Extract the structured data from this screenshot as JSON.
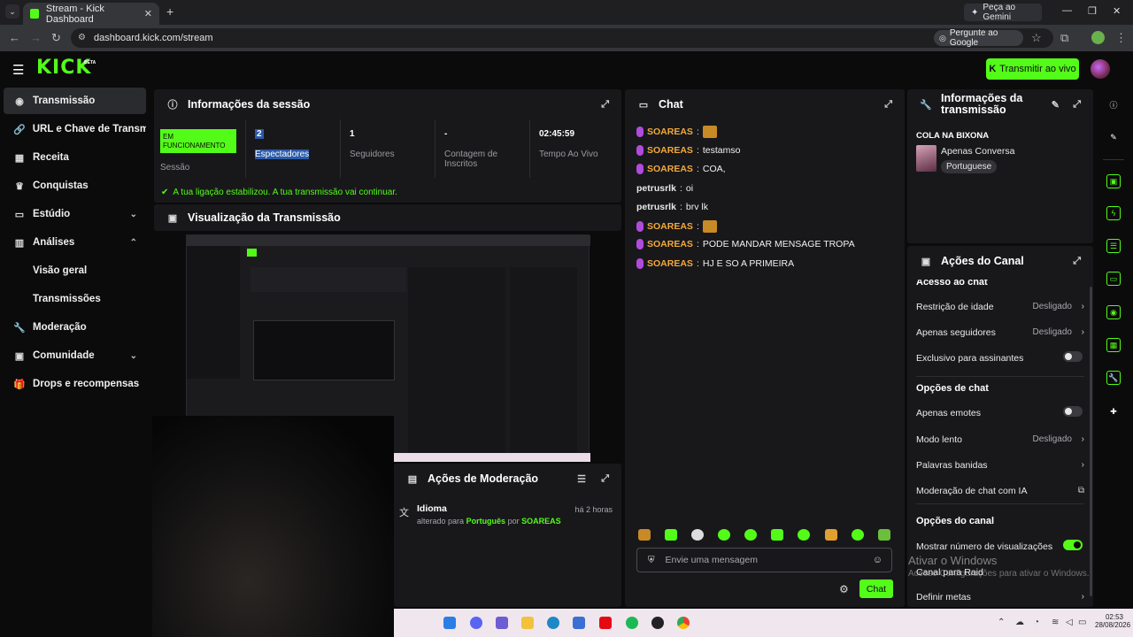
{
  "browser": {
    "tab_title": "Stream - Kick Dashboard",
    "gemini_label": "Peça ao Gemini",
    "url": "dashboard.kick.com/stream",
    "ask_google_label": "Pergunte ao Google"
  },
  "header": {
    "logo": "KICK",
    "logo_badge": "BETA",
    "go_live_label": "Transmitir ao vivo"
  },
  "sidebar": {
    "items": [
      {
        "label": "Transmissão"
      },
      {
        "label": "URL e Chave de Transmissão"
      },
      {
        "label": "Receita"
      },
      {
        "label": "Conquistas"
      },
      {
        "label": "Estúdio"
      },
      {
        "label": "Análises"
      },
      {
        "label": "Moderação"
      },
      {
        "label": "Comunidade"
      },
      {
        "label": "Drops e recompensas"
      }
    ],
    "sub_items": [
      "Visão geral",
      "Transmissões"
    ]
  },
  "session": {
    "title": "Informações da sessão",
    "status_badge": "EM FUNCIONAMENTO",
    "status_label": "Sessão",
    "viewers_value": "2",
    "viewers_label": "Espectadores",
    "followers_value": "1",
    "followers_label": "Seguidores",
    "subs_value": "-",
    "subs_label": "Contagem de Inscritos",
    "uptime_value": "02:45:59",
    "uptime_label": "Tempo Ao Vivo",
    "notice": "A tua ligação estabilizou. A tua transmissão vai continuar."
  },
  "preview": {
    "title": "Visualização da Transmissão"
  },
  "moderation": {
    "title": "Ações de Moderação",
    "item_title": "Idioma",
    "item_time": "há 2 horas",
    "item_prefix": "alterado para",
    "item_value": "Português",
    "item_by": "por",
    "item_user": "SOAREAS"
  },
  "chat": {
    "title": "Chat",
    "messages": [
      {
        "user": "SOAREAS",
        "text": ""
      },
      {
        "user": "SOAREAS",
        "text": "testamso"
      },
      {
        "user": "SOAREAS",
        "text": "COA,"
      },
      {
        "user": "petrusrlk",
        "text": "oi"
      },
      {
        "user": "petrusrlk",
        "text": "brv lk"
      },
      {
        "user": "SOAREAS",
        "text": ""
      },
      {
        "user": "SOAREAS",
        "text": "PODE MANDAR MENSAGE TROPA"
      },
      {
        "user": "SOAREAS",
        "text": "HJ E SO A PRIMEIRA"
      }
    ],
    "input_placeholder": "Envie uma mensagem",
    "send_label": "Chat"
  },
  "stream_info": {
    "title": "Informações da transmissão",
    "stream_title": "COLA NA BIXONA",
    "category": "Apenas Conversa",
    "language_tag": "Portuguese"
  },
  "channel_actions": {
    "title": "Ações do Canal",
    "section_chat_access": "Acesso ao chat",
    "age_restriction": "Restrição de idade",
    "age_restriction_value": "Desligado",
    "followers_only": "Apenas seguidores",
    "followers_only_value": "Desligado",
    "subs_only": "Exclusivo para assinantes",
    "section_chat_options": "Opções de chat",
    "emotes_only": "Apenas emotes",
    "slow_mode": "Modo lento",
    "slow_mode_value": "Desligado",
    "banned_words": "Palavras banidas",
    "ai_moderation": "Moderação de chat com IA",
    "section_channel_options": "Opções do canal",
    "show_views": "Mostrar número de visualizações",
    "raid_channel": "Canal para Raid",
    "set_goals": "Definir metas"
  },
  "windows_watermark": {
    "title": "Ativar o Windows",
    "subtitle": "Acesse Configurações para ativar o Windows."
  },
  "taskbar": {
    "time": "02:53",
    "date": "28/08/2026"
  },
  "colors": {
    "accent": "#53fc18",
    "panel": "#18181b",
    "background": "#0b0b0c",
    "username": "#f3a93a"
  }
}
